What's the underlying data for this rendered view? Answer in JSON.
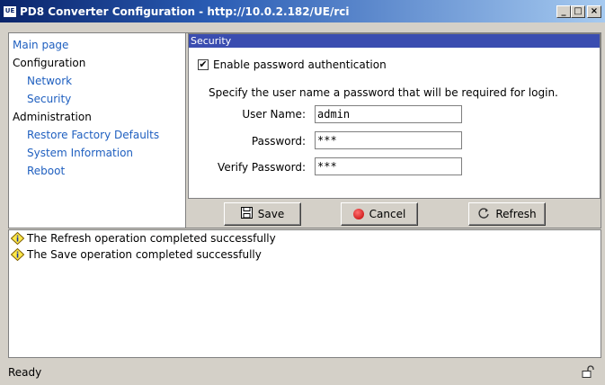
{
  "window": {
    "app_icon_text": "UE",
    "title": "PD8 Converter Configuration - http://10.0.2.182/UE/rci",
    "minimize": "_",
    "maximize": "□",
    "close": "×"
  },
  "nav": {
    "items": [
      {
        "label": "Main page",
        "kind": "link"
      },
      {
        "label": "Configuration",
        "kind": "category"
      },
      {
        "label": "Network",
        "kind": "link"
      },
      {
        "label": "Security",
        "kind": "link"
      },
      {
        "label": "Administration",
        "kind": "category"
      },
      {
        "label": "Restore Factory Defaults",
        "kind": "link"
      },
      {
        "label": "System Information",
        "kind": "link"
      },
      {
        "label": "Reboot",
        "kind": "link"
      }
    ]
  },
  "security": {
    "header": "Security",
    "enable_password_label": "Enable password authentication",
    "enable_password_checked": true,
    "checkmark": "✔",
    "description": "Specify the user name a password that will be required for login.",
    "username_label": "User Name:",
    "username_value": "admin",
    "password_label": "Password:",
    "password_value": "***",
    "verify_label": "Verify Password:",
    "verify_value": "***"
  },
  "buttons": {
    "save": "Save",
    "cancel": "Cancel",
    "refresh": "Refresh"
  },
  "log": {
    "messages": [
      "The Refresh operation completed successfully",
      "The Save operation completed successfully"
    ]
  },
  "status": {
    "text": "Ready",
    "lock_icon": "unlock-icon"
  },
  "colors": {
    "title_bar": "#0a246a",
    "section_header": "#3a4db0",
    "link": "#2060c0",
    "window_bg": "#d4d0c8"
  }
}
